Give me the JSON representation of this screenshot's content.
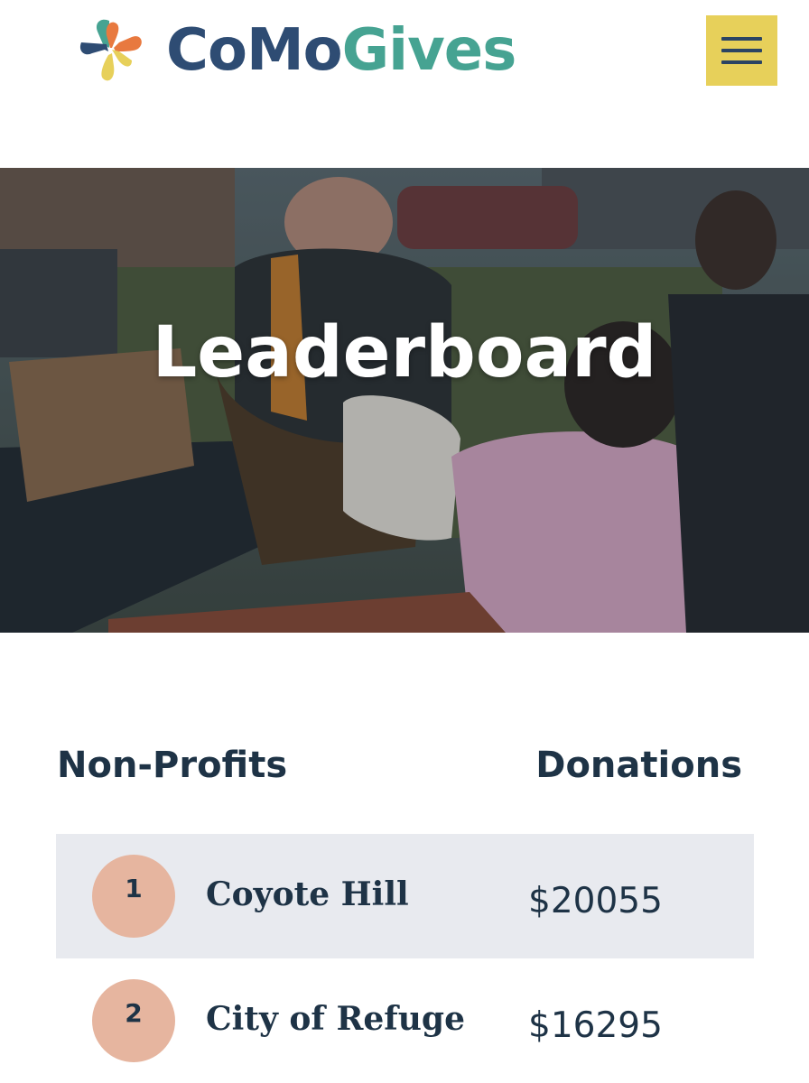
{
  "brand": {
    "name_part1": "CoMo",
    "name_part2": "Gives",
    "colors": {
      "como": "#2e4c73",
      "gives": "#46a392",
      "menu": "#e7d05a"
    }
  },
  "header": {
    "menu_icon": "hamburger-menu-icon"
  },
  "hero": {
    "title": "Leaderboard"
  },
  "table": {
    "headers": {
      "left": "Non-Profits",
      "right": "Donations"
    },
    "rows": [
      {
        "rank": "1",
        "name": "Coyote Hill",
        "amount": "$20055"
      },
      {
        "rank": "2",
        "name": "City of Refuge",
        "amount": "$16295"
      }
    ]
  }
}
